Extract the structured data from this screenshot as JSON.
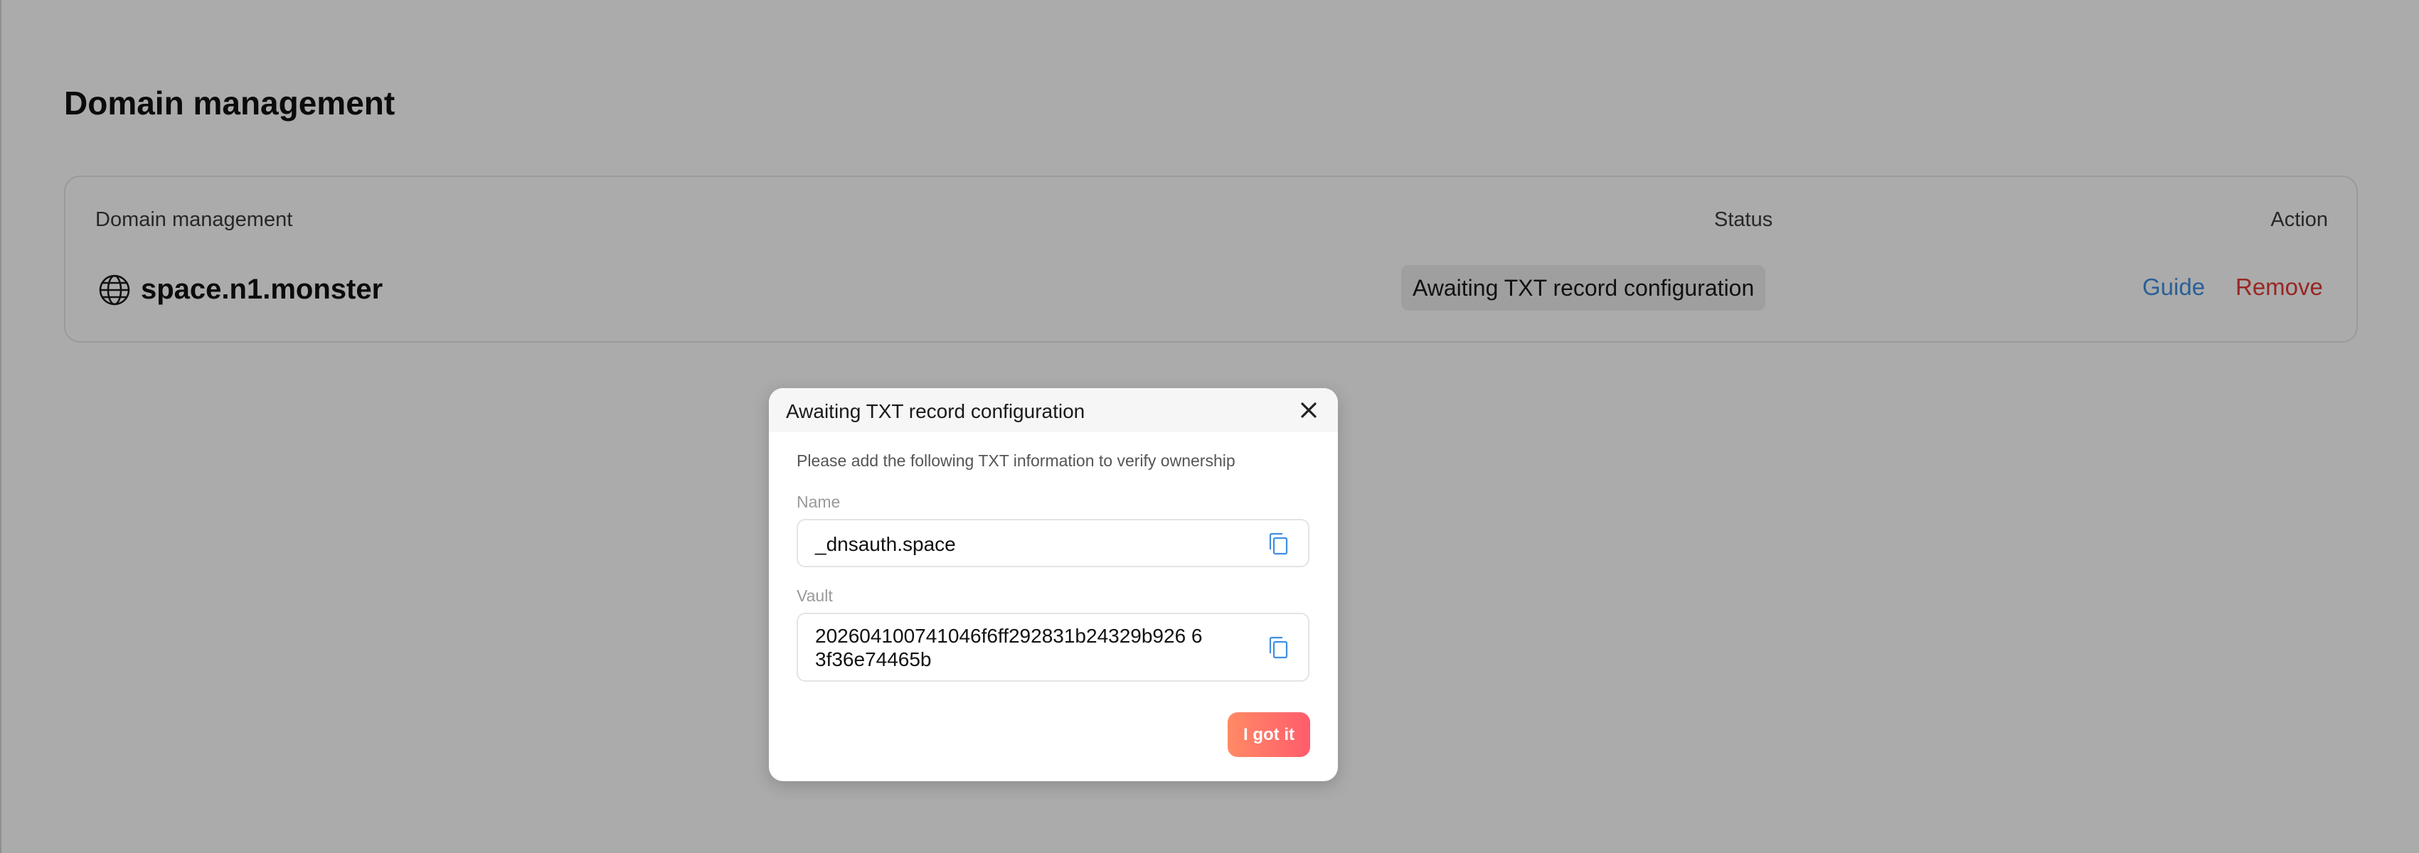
{
  "page": {
    "title": "Domain management"
  },
  "domain_table": {
    "headers": {
      "domain": "Domain management",
      "status": "Status",
      "action": "Action"
    },
    "rows": [
      {
        "icon": "globe-icon",
        "domain": "space.n1.monster",
        "status": "Awaiting TXT record configuration",
        "guide_label": "Guide",
        "remove_label": "Remove"
      }
    ]
  },
  "modal": {
    "title": "Awaiting TXT record configuration",
    "close_icon": "close-icon",
    "description": "Please add the following TXT information to verify ownership",
    "name_label": "Name",
    "name_value": "_dnsauth.space",
    "vault_label": "Vault",
    "vault_value": "202604100741046f6ff292831b24329b926 63f36e74465b",
    "copy_icon": "copy-icon",
    "confirm_label": "I got it"
  },
  "colors": {
    "overlay": "#0000004f",
    "guide_link": "#3f8fe0",
    "remove_link": "#e53935",
    "button_gradient_start": "#ff8a65",
    "button_gradient_end": "#ff5c6c",
    "copy_icon": "#3f8fe0"
  }
}
